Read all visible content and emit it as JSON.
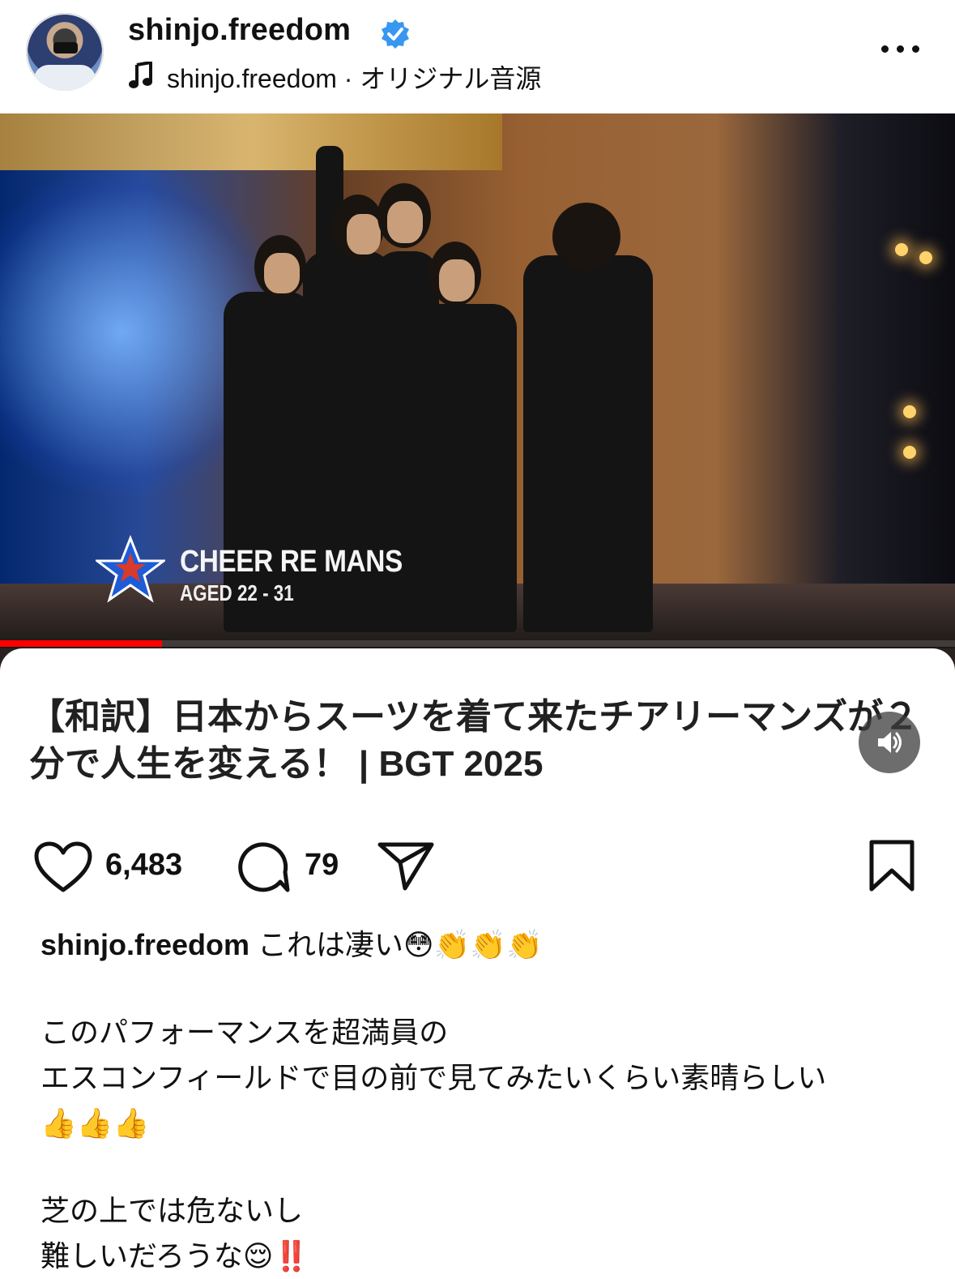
{
  "header": {
    "username": "shinjo.freedom",
    "audio": "shinjo.freedom · オリジナル音源"
  },
  "media": {
    "caption_name": "CHEER RE MANS",
    "caption_age": "AGED 22 - 31",
    "video_title": "【和訳】日本からスーツを着て来たチアリーマンズが２分で人生を変える！ | BGT 2025",
    "progress": 0.17
  },
  "actions": {
    "likes": "6,483",
    "comments": "79"
  },
  "caption": {
    "username": "shinjo.freedom",
    "line1": "これは凄い😳👏👏👏",
    "line2": "このパフォーマンスを超満員の",
    "line3": "エスコンフィールドで目の前で見てみたいくらい素晴らしい",
    "line4": "👍👍👍",
    "line5": "芝の上では危ないし",
    "line6": "難しいだろうな😌‼️"
  },
  "colors": {
    "verified": "#3897f0",
    "progress": "#ff0000"
  },
  "icons": [
    "music-note-icon",
    "verified-icon",
    "more-icon",
    "sound-icon",
    "heart-icon",
    "comment-icon",
    "share-icon",
    "bookmark-icon"
  ]
}
